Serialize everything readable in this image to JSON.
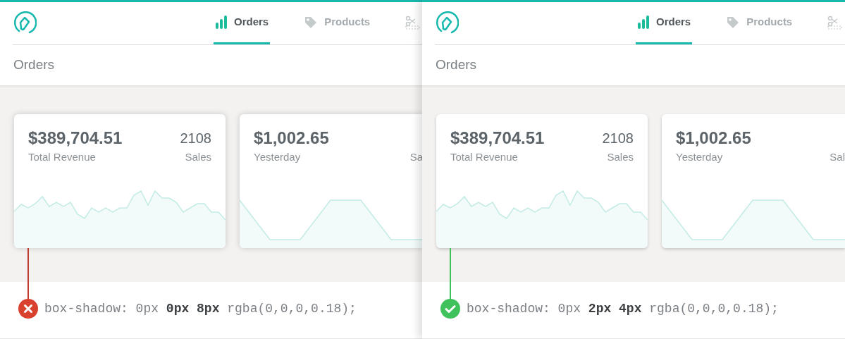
{
  "panels": [
    {
      "kind": "bad",
      "tabs": [
        {
          "label": "Orders",
          "selected": true,
          "kind": "bars"
        },
        {
          "label": "Products",
          "selected": false,
          "kind": "tag"
        },
        {
          "selected": false,
          "kind": "scissors"
        }
      ],
      "page_title": "Orders",
      "cards": [
        {
          "amount": "$389,704.51",
          "caption": "Total Revenue",
          "count": "2108",
          "count_label": "Sales"
        },
        {
          "amount": "$1,002.65",
          "caption": "Yesterday",
          "count_label": "Sa"
        }
      ],
      "code": "box-shadow: 0px **0px 8px** rgba(0,0,0,0.18);"
    },
    {
      "kind": "good",
      "tabs": [
        {
          "label": "Orders",
          "selected": true,
          "kind": "bars"
        },
        {
          "label": "Products",
          "selected": false,
          "kind": "tag"
        },
        {
          "selected": false,
          "kind": "scissors"
        }
      ],
      "page_title": "Orders",
      "cards": [
        {
          "amount": "$389,704.51",
          "caption": "Total Revenue",
          "count": "2108",
          "count_label": "Sales"
        },
        {
          "amount": "$1,002.65",
          "caption": "Yesterday",
          "count_label": "Sal"
        }
      ],
      "code": "box-shadow: 0px **2px 4px** rgba(0,0,0,0.18);"
    }
  ]
}
